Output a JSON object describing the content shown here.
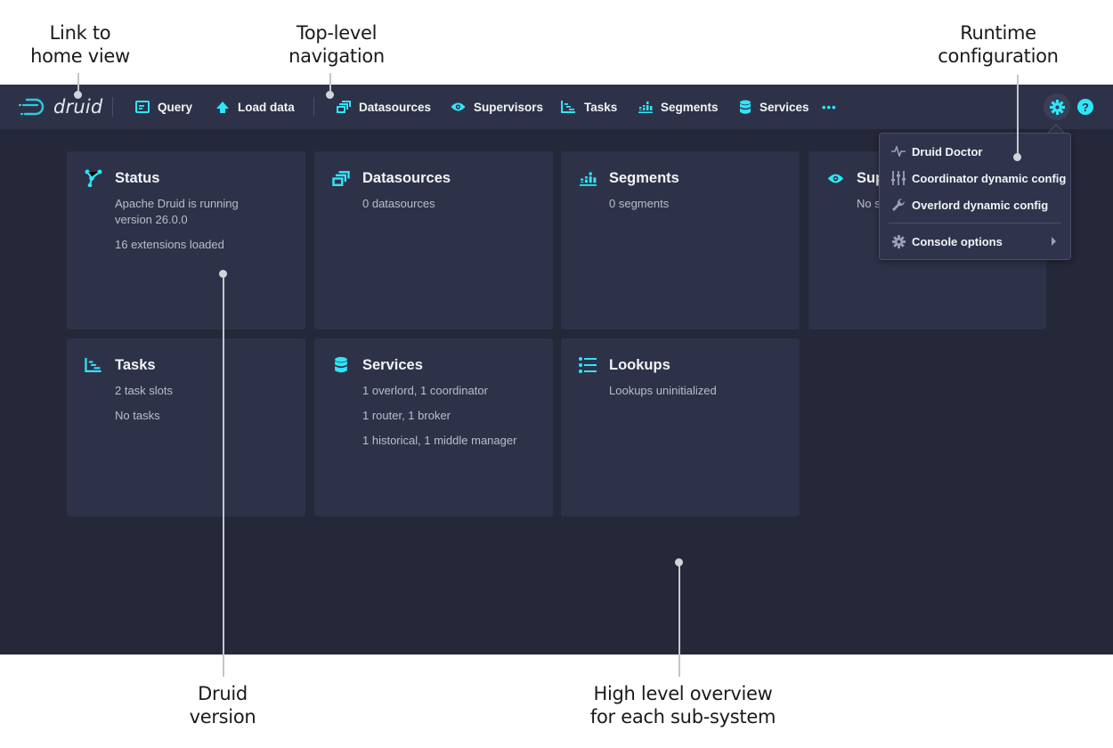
{
  "annotations": {
    "home_link": [
      "Link to",
      "home view"
    ],
    "top_nav": [
      "Top-level",
      "navigation"
    ],
    "runtime_config": [
      "Runtime",
      "configuration"
    ],
    "druid_version": [
      "Druid",
      "version"
    ],
    "overview": [
      "High level overview",
      "for each sub-system"
    ]
  },
  "brand": {
    "logo_text": "druid",
    "accent_color": "#2ee6f6",
    "navbar_color": "#2e3249",
    "background_color": "#252839"
  },
  "nav": {
    "items": [
      {
        "label": "Query",
        "icon": "query-icon"
      },
      {
        "label": "Load data",
        "icon": "cloud-upload-icon"
      },
      {
        "label": "Datasources",
        "icon": "multi-window-icon"
      },
      {
        "label": "Supervisors",
        "icon": "eye-icon"
      },
      {
        "label": "Tasks",
        "icon": "gantt-chart-icon"
      },
      {
        "label": "Segments",
        "icon": "stacked-chart-icon"
      },
      {
        "label": "Services",
        "icon": "database-icon"
      }
    ],
    "more_label": "•••",
    "help_label": "?"
  },
  "cards": [
    {
      "title": "Status",
      "icon": "graph-icon",
      "lines": [
        "Apache Druid is running version 26.0.0",
        "16 extensions loaded"
      ]
    },
    {
      "title": "Datasources",
      "icon": "multi-window-icon",
      "lines": [
        "0 datasources"
      ]
    },
    {
      "title": "Segments",
      "icon": "stacked-chart-icon",
      "lines": [
        "0 segments"
      ]
    },
    {
      "title": "Supervisors",
      "icon": "eye-icon",
      "lines": [
        "No supervisors"
      ]
    },
    {
      "title": "Tasks",
      "icon": "gantt-chart-icon",
      "lines": [
        "2 task slots",
        "No tasks"
      ]
    },
    {
      "title": "Services",
      "icon": "database-icon",
      "lines": [
        "1 overlord, 1 coordinator",
        "1 router, 1 broker",
        "1 historical, 1 middle manager"
      ]
    },
    {
      "title": "Lookups",
      "icon": "properties-icon",
      "lines": [
        "Lookups uninitialized"
      ]
    }
  ],
  "config_menu": {
    "items": [
      {
        "label": "Druid Doctor",
        "icon": "pulse-icon"
      },
      {
        "label": "Coordinator dynamic config",
        "icon": "sliders-icon"
      },
      {
        "label": "Overlord dynamic config",
        "icon": "wrench-icon"
      },
      {
        "label": "Console options",
        "icon": "cog-icon",
        "has_submenu": true
      }
    ]
  }
}
